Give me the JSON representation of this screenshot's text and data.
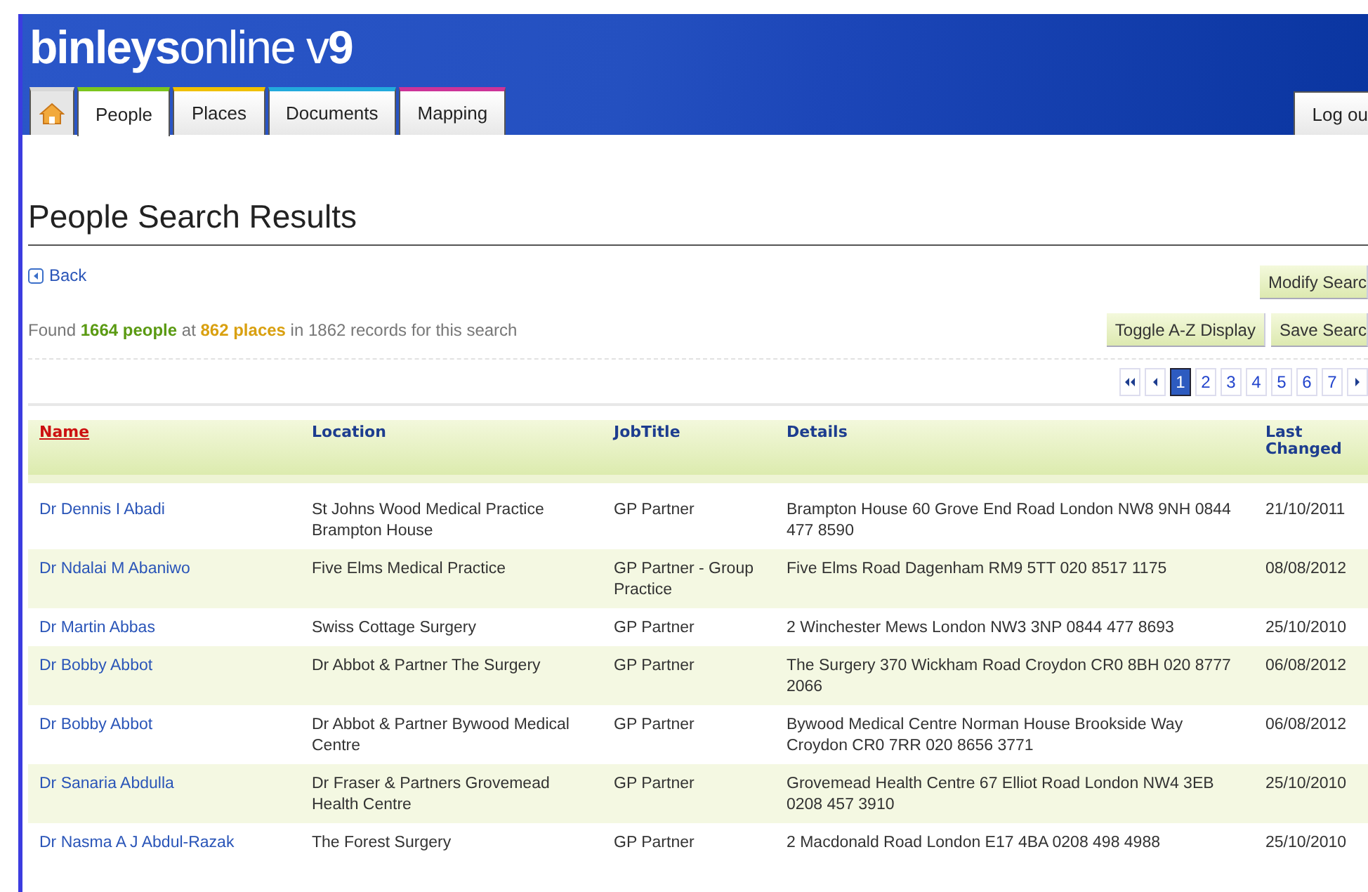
{
  "header": {
    "logo": "**binleys**online v**9**",
    "logout": "Log ou"
  },
  "tabs": [
    {
      "kind": "home",
      "selected": false,
      "color": "#d8d8d8"
    },
    {
      "kind": "text",
      "label": "People",
      "selected": true,
      "color": "#7cc61e"
    },
    {
      "kind": "text",
      "label": "Places",
      "selected": false,
      "color": "#f0c000"
    },
    {
      "kind": "text",
      "label": "Documents",
      "selected": false,
      "color": "#22aadd"
    },
    {
      "kind": "text",
      "label": "Mapping",
      "selected": false,
      "color": "#cc3399"
    }
  ],
  "heading": "People Search Results",
  "back": "Back",
  "buttons": {
    "modify": "Modify Searc",
    "toggle": "Toggle A-Z Display",
    "save": "Save Searc"
  },
  "summary": [
    {
      "kind": "plain",
      "text": "Found "
    },
    {
      "kind": "people",
      "text": "1664 people"
    },
    {
      "kind": "plain",
      "text": " at "
    },
    {
      "kind": "places",
      "text": "862 places"
    },
    {
      "kind": "plain",
      "text": " in 1862 records for this search"
    }
  ],
  "pagination": [
    {
      "kind": "first"
    },
    {
      "kind": "prev"
    },
    {
      "kind": "page",
      "label": "1",
      "selected": true
    },
    {
      "kind": "page",
      "label": "2",
      "selected": false
    },
    {
      "kind": "page",
      "label": "3",
      "selected": false
    },
    {
      "kind": "page",
      "label": "4",
      "selected": false
    },
    {
      "kind": "page",
      "label": "5",
      "selected": false
    },
    {
      "kind": "page",
      "label": "6",
      "selected": false
    },
    {
      "kind": "page",
      "label": "7",
      "selected": false
    },
    {
      "kind": "next"
    }
  ],
  "table": {
    "columns": [
      {
        "label": "Name",
        "sorted": true
      },
      {
        "label": "Location",
        "sorted": false
      },
      {
        "label": "JobTitle",
        "sorted": false
      },
      {
        "label": "Details",
        "sorted": false
      },
      {
        "label": "Last Changed",
        "sorted": false
      }
    ],
    "rows": [
      [
        "Dr Dennis I Abadi",
        "St Johns Wood Medical Practice Brampton House",
        "GP Partner",
        "Brampton House 60 Grove End Road London NW8 9NH 0844 477 8590",
        "21/10/2011"
      ],
      [
        "Dr Ndalai M Abaniwo",
        "Five Elms Medical Practice",
        "GP Partner - Group Practice",
        "Five Elms Road Dagenham RM9 5TT 020 8517 1175",
        "08/08/2012"
      ],
      [
        "Dr Martin Abbas",
        "Swiss Cottage Surgery",
        "GP Partner",
        "2 Winchester Mews London NW3 3NP 0844 477 8693",
        "25/10/2010"
      ],
      [
        "Dr Bobby Abbot",
        "Dr Abbot & Partner The Surgery",
        "GP Partner",
        "The Surgery 370 Wickham Road Croydon CR0 8BH 020 8777 2066",
        "06/08/2012"
      ],
      [
        "Dr Bobby Abbot",
        "Dr Abbot & Partner Bywood Medical Centre",
        "GP Partner",
        "Bywood Medical Centre Norman House Brookside Way Croydon CR0 7RR 020 8656 3771",
        "06/08/2012"
      ],
      [
        "Dr Sanaria Abdulla",
        "Dr Fraser & Partners Grovemead Health Centre",
        "GP Partner",
        "Grovemead Health Centre 67 Elliot Road London NW4 3EB 0208 457 3910",
        "25/10/2010"
      ],
      [
        "Dr Nasma A J Abdul-Razak",
        "The Forest Surgery",
        "GP Partner",
        "2 Macdonald Road London E17 4BA 0208 498 4988",
        "25/10/2010"
      ]
    ]
  }
}
